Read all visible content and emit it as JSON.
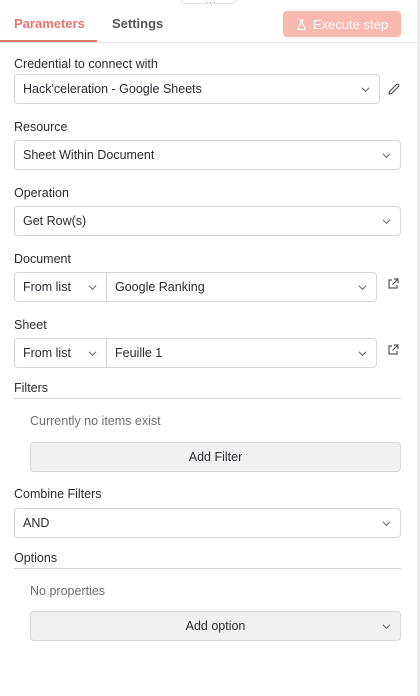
{
  "header": {
    "tabs": [
      {
        "label": "Parameters",
        "active": true
      },
      {
        "label": "Settings",
        "active": false
      }
    ],
    "execute_label": "Execute step",
    "accent_color": "#e9756a"
  },
  "credential": {
    "label": "Credential to connect with",
    "value": "Hack'celeration - Google Sheets"
  },
  "resource": {
    "label": "Resource",
    "value": "Sheet Within Document"
  },
  "operation": {
    "label": "Operation",
    "value": "Get Row(s)"
  },
  "document": {
    "label": "Document",
    "mode": "From list",
    "value": "Google Ranking"
  },
  "sheet": {
    "label": "Sheet",
    "mode": "From list",
    "value": "Feuille 1"
  },
  "filters": {
    "title": "Filters",
    "empty_text": "Currently no items exist",
    "add_label": "Add Filter"
  },
  "combine": {
    "label": "Combine Filters",
    "value": "AND"
  },
  "options": {
    "title": "Options",
    "empty_text": "No properties",
    "add_label": "Add option"
  }
}
